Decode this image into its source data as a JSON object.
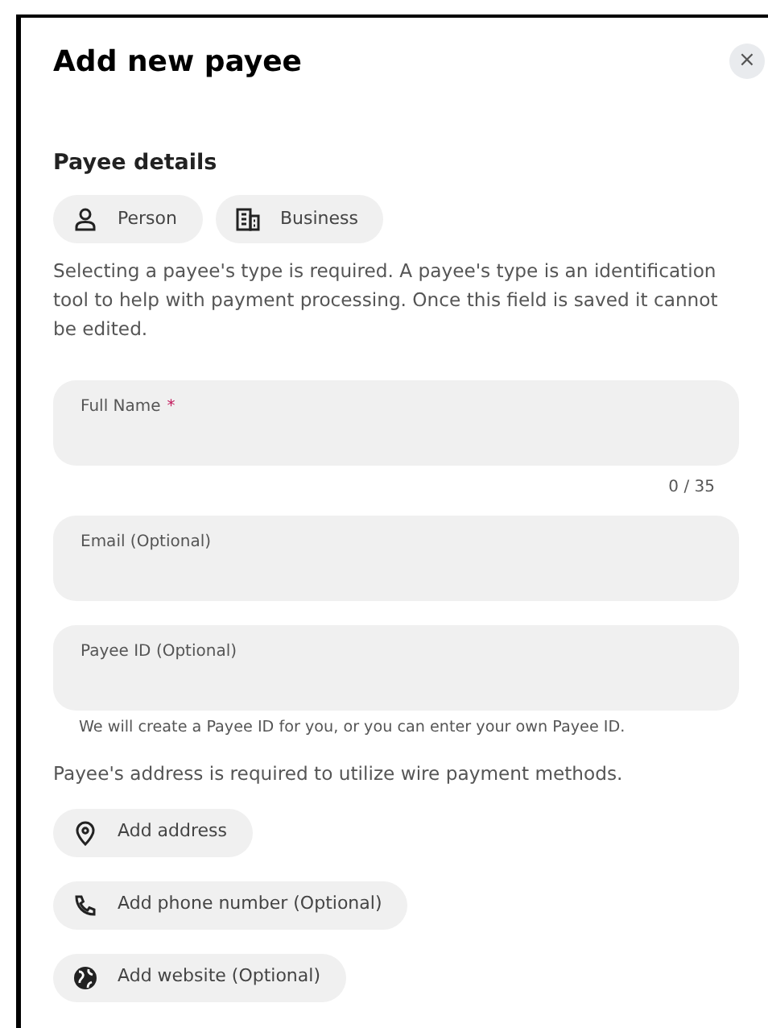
{
  "dialog": {
    "title": "Add new payee",
    "close": "×"
  },
  "section_title": "Payee details",
  "payee_types": [
    {
      "label": "Person",
      "selected": false
    },
    {
      "label": "Business",
      "selected": false
    }
  ],
  "type_note": "Selecting a payee's type is required. A payee's type is an identification tool to help with payment processing. Once this field is saved it cannot be edited.",
  "fields": [
    {
      "label": "Full Name",
      "required_mark": "*",
      "counter": "0 / 35"
    },
    {
      "label": "Email (Optional)"
    },
    {
      "label": "Payee ID (Optional)",
      "help": "We will create a Payee ID for you, or you can enter your own Payee ID."
    }
  ],
  "address_note": "Payee's address is required to utilize wire payment methods.",
  "actions": [
    {
      "label": "Add address"
    },
    {
      "label": "Add phone number (Optional)"
    },
    {
      "label": "Add website (Optional)"
    }
  ]
}
